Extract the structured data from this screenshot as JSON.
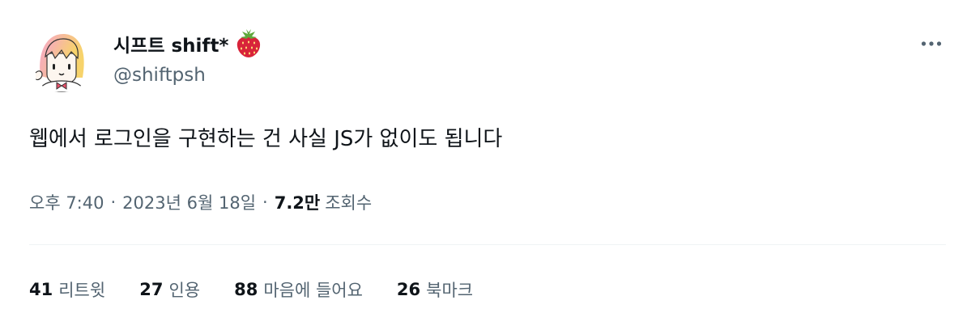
{
  "author": {
    "display_name": "시프트 shift*",
    "handle": "@shiftpsh",
    "name_emoji": "strawberry-emoji"
  },
  "tweet": {
    "text": "웹에서 로그인을 구현하는 건 사실 JS가 없이도 됩니다"
  },
  "meta": {
    "time": "오후 7:40",
    "separator": "·",
    "date": "2023년 6월 18일",
    "views_count": "7.2만",
    "views_label": "조회수"
  },
  "stats": [
    {
      "count": "41",
      "label": "리트윗"
    },
    {
      "count": "27",
      "label": "인용"
    },
    {
      "count": "88",
      "label": "마음에 들어요"
    },
    {
      "count": "26",
      "label": "북마크"
    }
  ],
  "colors": {
    "text_primary": "#0f1419",
    "text_secondary": "#536471",
    "divider": "#eff3f4"
  },
  "icons": [
    "avatar-illustration",
    "strawberry-emoji",
    "more-dots-icon"
  ]
}
